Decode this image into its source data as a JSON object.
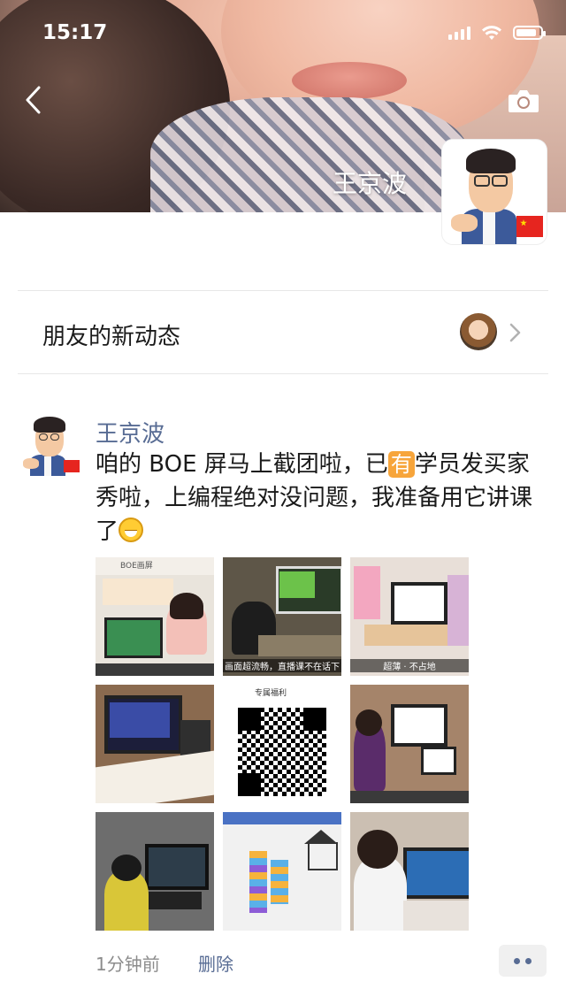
{
  "status_bar": {
    "time": "15:17"
  },
  "profile": {
    "name": "王京波"
  },
  "friends_updates": {
    "label": "朋友的新动态"
  },
  "post": {
    "author": "王京波",
    "text_before_badge": "咱的 BOE 屏马上截团啦，已",
    "badge": "有",
    "text_after_badge": "学员发买家秀啦，上编程绝对没问题，我准备用它讲课了",
    "images": [
      {
        "name": "boe-promo",
        "top_text": "BOE画屏",
        "caption": ""
      },
      {
        "name": "scratch-desk",
        "caption": "画面超流畅，直播课不在话下"
      },
      {
        "name": "desk-setup",
        "caption": "超薄 · 不占地"
      },
      {
        "name": "monitor-lesson",
        "caption": ""
      },
      {
        "name": "qr-code",
        "top_text": "专属福利",
        "caption": ""
      },
      {
        "name": "kid-at-screen",
        "caption": ""
      },
      {
        "name": "boy-coding",
        "caption": ""
      },
      {
        "name": "scratch-house",
        "caption": ""
      },
      {
        "name": "girl-screen",
        "caption": ""
      }
    ],
    "time": "1分钟前",
    "delete_label": "删除"
  },
  "colors": {
    "link": "#586c94",
    "badge": "#f7a53b"
  }
}
